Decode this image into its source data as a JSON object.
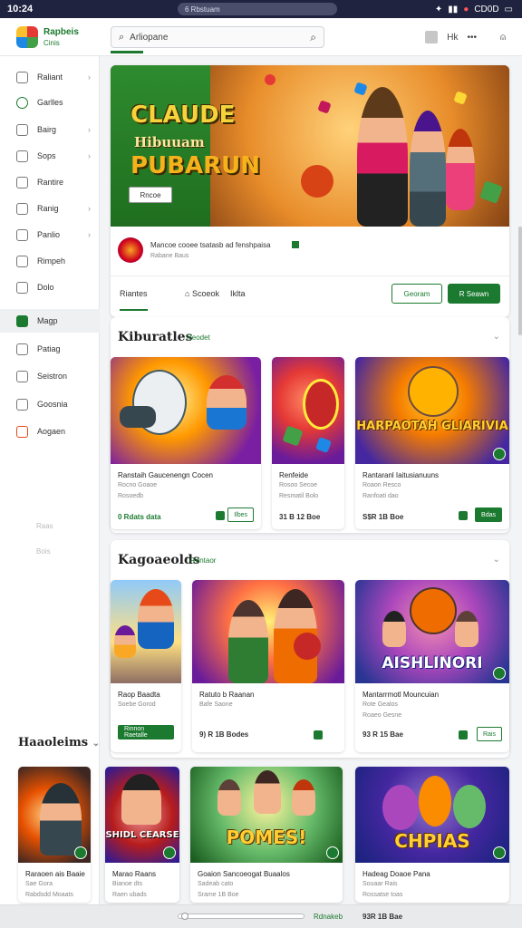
{
  "status": {
    "time": "10:24",
    "url": "6 Rbstuam",
    "battery": "CD0D"
  },
  "app": {
    "brand": "Rapbeis",
    "brand_sub": "Cinis"
  },
  "search": {
    "placeholder": "Arliopane"
  },
  "top": {
    "label": "Hk"
  },
  "sidebar": {
    "items": [
      {
        "label": "Raliant",
        "icon": "clock-icon",
        "chev": true
      },
      {
        "label": "Garlles",
        "icon": "globe-icon",
        "chev": false
      },
      {
        "label": "Bairg",
        "icon": "book-icon",
        "chev": true
      },
      {
        "label": "Sops",
        "icon": "bell-icon",
        "chev": true
      },
      {
        "label": "Rantire",
        "icon": "copy-icon",
        "chev": false
      },
      {
        "label": "Ranig",
        "icon": "image-icon",
        "chev": true
      },
      {
        "label": "Panlio",
        "icon": "cart-icon",
        "chev": true
      },
      {
        "label": "Rimpeh",
        "icon": "map-icon",
        "chev": false
      },
      {
        "label": "Dolo",
        "icon": "chat-icon",
        "chev": false
      },
      {
        "label": "Magp",
        "icon": "play-icon",
        "chev": false
      },
      {
        "label": "Patiag",
        "icon": "list-icon",
        "chev": false
      },
      {
        "label": "Seistron",
        "icon": "window-icon",
        "chev": false
      },
      {
        "label": "Goosnia",
        "icon": "gear-icon",
        "chev": false
      },
      {
        "label": "Aogaen",
        "icon": "flag-icon",
        "chev": false
      }
    ],
    "faint": [
      "Raas",
      "Bois"
    ]
  },
  "hero": {
    "title1": "CLAUDE",
    "subtitle": "Hibuuam",
    "title2": "PUBARUN",
    "button": "Rncoe",
    "meta_title": "Mancoe cooee tsatasb  ad fenshpaisa",
    "meta_sub": "Rabane Baus",
    "tabs": [
      "Riantes",
      "Scoeok",
      "Iklta"
    ],
    "btn_outline": "Georam",
    "btn_solid": "R Seawn"
  },
  "section1": {
    "title": "Kiburatles",
    "tag": "Reodet",
    "cards": [
      {
        "name": "Ranstaih Gaucenengn Cocen",
        "sub1": "Rocno Goaoe",
        "sub2": "Rosoedb",
        "price": "0 Rdats data",
        "btn": "Ilbes"
      },
      {
        "name": "Renfeide",
        "sub1": "Rosoo Secoe",
        "sub2": "Resmatil  Bolo",
        "price": "31 B 12 Boe",
        "btn": ""
      },
      {
        "name": "Rantaranl Iaitusianuuns",
        "sub1": "Roaon Resco",
        "sub2": "Ranfoati dao",
        "price": "S$R 1B Boe",
        "btn": "Bdas",
        "art_text": "HARPAOTAH GLIARIVIA"
      }
    ]
  },
  "section2": {
    "title": "Kagoaeolds",
    "tag": "Rentaor",
    "cards": [
      {
        "name": "Raop Baadta",
        "sub1": "Soebe Gorod",
        "sub2": "",
        "price": "",
        "btn": "Rinnon Raetalle"
      },
      {
        "name": "Ratuto b Raanan",
        "sub1": "Bafe Saone",
        "sub2": "",
        "price": "9) R 1B Bodes",
        "btn": ""
      },
      {
        "name": "Mantarrmotl Mouncuian",
        "sub1": "Rote Gealos",
        "sub2": "Roaeo Gesne",
        "price": "93 R 15 Bae",
        "btn": "Rais",
        "art_text": "AISHLINORI"
      }
    ]
  },
  "section3": {
    "title": "Haaoleims",
    "cards": [
      {
        "name": "Raraoen ais Baaie",
        "sub1": "Sae Gora",
        "sub2": "Rabdsdd Moaats",
        "art_text": ""
      },
      {
        "name": "Marao Raans",
        "sub1": "Bianoe dts",
        "sub2": "Raen ubads",
        "art_text": "SHIDL CEARSE"
      },
      {
        "name": "Goaion Sancoeogat Buaalos",
        "sub1": "Sadeab cato",
        "sub2": "Srame 1B Boe",
        "art_text": "POMES!"
      },
      {
        "name": "Hadeag Doaoe Pana",
        "sub1": "Souaar Rais",
        "sub2": "Rossatse toas",
        "art_text": "CHPIAS"
      }
    ]
  },
  "bottom": {
    "text": "Rdnakeb",
    "price": "93R 1B Bae"
  },
  "colors": {
    "accent": "#1b7a2f"
  }
}
